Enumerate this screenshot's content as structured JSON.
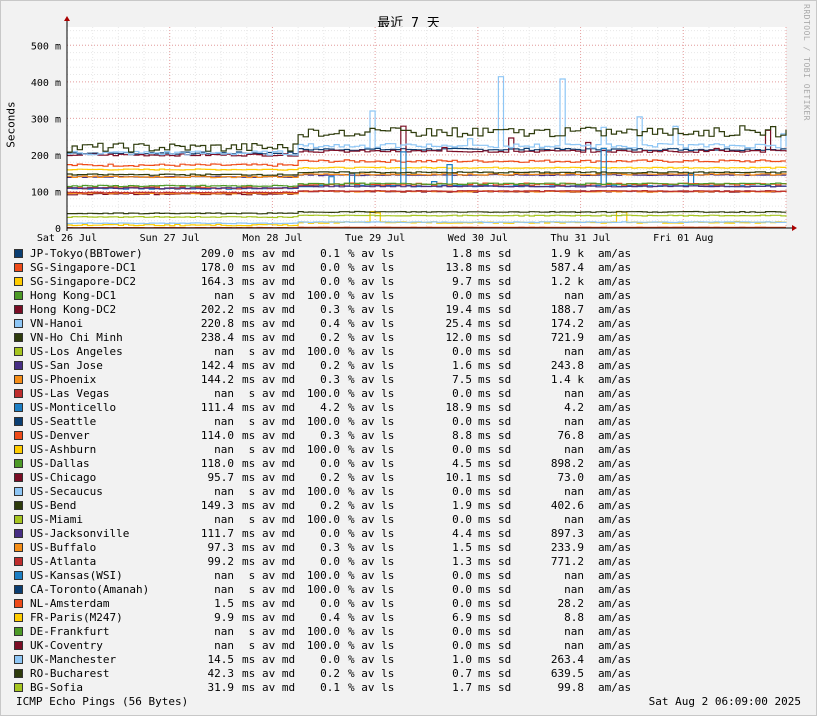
{
  "chart_data": {
    "type": "line",
    "title": "最近 7 天",
    "ylabel": "Seconds",
    "ylim": [
      0,
      0.55
    ],
    "yticks": [
      {
        "v": 0,
        "label": "0"
      },
      {
        "v": 0.1,
        "label": "100 m"
      },
      {
        "v": 0.2,
        "label": "200 m"
      },
      {
        "v": 0.3,
        "label": "300 m"
      },
      {
        "v": 0.4,
        "label": "400 m"
      },
      {
        "v": 0.5,
        "label": "500 m"
      }
    ],
    "xticks": [
      "Sat 26 Jul",
      "Sun 27 Jul",
      "Mon 28 Jul",
      "Tue 29 Jul",
      "Wed 30 Jul",
      "Thu 31 Jul",
      "Fri 01 Aug"
    ],
    "grid": true,
    "series": [
      {
        "name": "JP-Tokyo(BBTower)",
        "color": "#0b3e72",
        "median": 0.209,
        "y_hi": 0.215,
        "y_lo": 0.205,
        "spike": 0
      },
      {
        "name": "SG-Singapore-DC1",
        "color": "#ee4b19",
        "median": 0.178,
        "y_hi": 0.183,
        "y_lo": 0.172,
        "spike": 0
      },
      {
        "name": "SG-Singapore-DC2",
        "color": "#ffcc00",
        "median": 0.1643,
        "y_hi": 0.165,
        "y_lo": 0.16,
        "spike": 0
      },
      {
        "name": "Hong Kong-DC1",
        "color": "#4d9a27",
        "median": null,
        "y_hi": null,
        "y_lo": null,
        "spike": 0
      },
      {
        "name": "Hong Kong-DC2",
        "color": "#7b0d25",
        "median": 0.2022,
        "y_hi": 0.21,
        "y_lo": 0.2,
        "spike": 0.3
      },
      {
        "name": "VN-Hanoi",
        "color": "#8ec6f5",
        "median": 0.2208,
        "y_hi": 0.225,
        "y_lo": 0.205,
        "spike": 0.44
      },
      {
        "name": "VN-Ho Chi Minh",
        "color": "#2e3b0c",
        "median": 0.2384,
        "y_hi": 0.262,
        "y_lo": 0.22,
        "spike": 0.28
      },
      {
        "name": "US-Los Angeles",
        "color": "#a6c520",
        "median": null,
        "y_hi": null,
        "y_lo": null,
        "spike": 0
      },
      {
        "name": "US-San Jose",
        "color": "#472e84",
        "median": 0.1424,
        "y_hi": 0.145,
        "y_lo": 0.14,
        "spike": 0
      },
      {
        "name": "US-Phoenix",
        "color": "#f58d17",
        "median": 0.1442,
        "y_hi": 0.147,
        "y_lo": 0.14,
        "spike": 0
      },
      {
        "name": "US-Las Vegas",
        "color": "#be2d2d",
        "median": null,
        "y_hi": null,
        "y_lo": null,
        "spike": 0
      },
      {
        "name": "US-Monticello",
        "color": "#1d7fc4",
        "median": 0.1114,
        "y_hi": 0.115,
        "y_lo": 0.108,
        "spike": 0.23
      },
      {
        "name": "US-Seattle",
        "color": "#0b3e72",
        "median": null,
        "y_hi": null,
        "y_lo": null,
        "spike": 0
      },
      {
        "name": "US-Denver",
        "color": "#ee4b19",
        "median": 0.114,
        "y_hi": 0.12,
        "y_lo": 0.11,
        "spike": 0
      },
      {
        "name": "US-Ashburn",
        "color": "#ffcc00",
        "median": null,
        "y_hi": null,
        "y_lo": null,
        "spike": 0
      },
      {
        "name": "US-Dallas",
        "color": "#4d9a27",
        "median": 0.118,
        "y_hi": 0.121,
        "y_lo": 0.115,
        "spike": 0
      },
      {
        "name": "US-Chicago",
        "color": "#7b0d25",
        "median": 0.0957,
        "y_hi": 0.1,
        "y_lo": 0.093,
        "spike": 0
      },
      {
        "name": "US-Secaucus",
        "color": "#8ec6f5",
        "median": null,
        "y_hi": null,
        "y_lo": null,
        "spike": 0
      },
      {
        "name": "US-Bend",
        "color": "#2e3b0c",
        "median": 0.1493,
        "y_hi": 0.152,
        "y_lo": 0.146,
        "spike": 0
      },
      {
        "name": "US-Miami",
        "color": "#a6c520",
        "median": null,
        "y_hi": null,
        "y_lo": null,
        "spike": 0
      },
      {
        "name": "US-Jacksonville",
        "color": "#472e84",
        "median": 0.1117,
        "y_hi": 0.114,
        "y_lo": 0.109,
        "spike": 0
      },
      {
        "name": "US-Buffalo",
        "color": "#f58d17",
        "median": 0.0973,
        "y_hi": 0.1,
        "y_lo": 0.095,
        "spike": 0
      },
      {
        "name": "US-Atlanta",
        "color": "#be2d2d",
        "median": 0.0992,
        "y_hi": 0.101,
        "y_lo": 0.097,
        "spike": 0
      },
      {
        "name": "US-Kansas(WSI)",
        "color": "#1d7fc4",
        "median": null,
        "y_hi": null,
        "y_lo": null,
        "spike": 0
      },
      {
        "name": "CA-Toronto(Amanah)",
        "color": "#0b3e72",
        "median": null,
        "y_hi": null,
        "y_lo": null,
        "spike": 0
      },
      {
        "name": "NL-Amsterdam",
        "color": "#ee4b19",
        "median": 0.0015,
        "y_hi": 0.002,
        "y_lo": 0.001,
        "spike": 0
      },
      {
        "name": "FR-Paris(M247)",
        "color": "#ffcc00",
        "median": 0.0099,
        "y_hi": 0.015,
        "y_lo": 0.008,
        "spike": 0.05
      },
      {
        "name": "DE-Frankfurt",
        "color": "#4d9a27",
        "median": null,
        "y_hi": null,
        "y_lo": null,
        "spike": 0
      },
      {
        "name": "UK-Coventry",
        "color": "#7b0d25",
        "median": null,
        "y_hi": null,
        "y_lo": null,
        "spike": 0
      },
      {
        "name": "UK-Manchester",
        "color": "#8ec6f5",
        "median": 0.0145,
        "y_hi": 0.016,
        "y_lo": 0.013,
        "spike": 0
      },
      {
        "name": "RO-Bucharest",
        "color": "#2e3b0c",
        "median": 0.0423,
        "y_hi": 0.044,
        "y_lo": 0.04,
        "spike": 0
      },
      {
        "name": "BG-Sofia",
        "color": "#a6c520",
        "median": 0.0319,
        "y_hi": 0.034,
        "y_lo": 0.03,
        "spike": 0
      }
    ]
  },
  "legend": {
    "rows": [
      {
        "name": "JP-Tokyo(BBTower)",
        "avmd": "209.0",
        "avmd_unit": "ms",
        "loss": "0.1",
        "sd": "1.8",
        "sd_unit": "ms",
        "amas": "1.9 k"
      },
      {
        "name": "SG-Singapore-DC1",
        "avmd": "178.0",
        "avmd_unit": "ms",
        "loss": "0.0",
        "sd": "13.8",
        "sd_unit": "ms",
        "amas": "587.4"
      },
      {
        "name": "SG-Singapore-DC2",
        "avmd": "164.3",
        "avmd_unit": "ms",
        "loss": "0.0",
        "sd": "9.7",
        "sd_unit": "ms",
        "amas": "1.2 k"
      },
      {
        "name": "Hong Kong-DC1",
        "avmd": "nan",
        "avmd_unit": " s",
        "loss": "100.0",
        "sd": "0.0",
        "sd_unit": "ms",
        "amas": "nan"
      },
      {
        "name": "Hong Kong-DC2",
        "avmd": "202.2",
        "avmd_unit": "ms",
        "loss": "0.3",
        "sd": "19.4",
        "sd_unit": "ms",
        "amas": "188.7"
      },
      {
        "name": "VN-Hanoi",
        "avmd": "220.8",
        "avmd_unit": "ms",
        "loss": "0.4",
        "sd": "25.4",
        "sd_unit": "ms",
        "amas": "174.2"
      },
      {
        "name": "VN-Ho Chi Minh",
        "avmd": "238.4",
        "avmd_unit": "ms",
        "loss": "0.2",
        "sd": "12.0",
        "sd_unit": "ms",
        "amas": "721.9"
      },
      {
        "name": "US-Los Angeles",
        "avmd": "nan",
        "avmd_unit": " s",
        "loss": "100.0",
        "sd": "0.0",
        "sd_unit": "ms",
        "amas": "nan"
      },
      {
        "name": "US-San Jose",
        "avmd": "142.4",
        "avmd_unit": "ms",
        "loss": "0.2",
        "sd": "1.6",
        "sd_unit": "ms",
        "amas": "243.8"
      },
      {
        "name": "US-Phoenix",
        "avmd": "144.2",
        "avmd_unit": "ms",
        "loss": "0.3",
        "sd": "7.5",
        "sd_unit": "ms",
        "amas": "1.4 k"
      },
      {
        "name": "US-Las Vegas",
        "avmd": "nan",
        "avmd_unit": " s",
        "loss": "100.0",
        "sd": "0.0",
        "sd_unit": "ms",
        "amas": "nan"
      },
      {
        "name": "US-Monticello",
        "avmd": "111.4",
        "avmd_unit": "ms",
        "loss": "4.2",
        "sd": "18.9",
        "sd_unit": "ms",
        "amas": "4.2"
      },
      {
        "name": "US-Seattle",
        "avmd": "nan",
        "avmd_unit": " s",
        "loss": "100.0",
        "sd": "0.0",
        "sd_unit": "ms",
        "amas": "nan"
      },
      {
        "name": "US-Denver",
        "avmd": "114.0",
        "avmd_unit": "ms",
        "loss": "0.3",
        "sd": "8.8",
        "sd_unit": "ms",
        "amas": "76.8"
      },
      {
        "name": "US-Ashburn",
        "avmd": "nan",
        "avmd_unit": " s",
        "loss": "100.0",
        "sd": "0.0",
        "sd_unit": "ms",
        "amas": "nan"
      },
      {
        "name": "US-Dallas",
        "avmd": "118.0",
        "avmd_unit": "ms",
        "loss": "0.0",
        "sd": "4.5",
        "sd_unit": "ms",
        "amas": "898.2"
      },
      {
        "name": "US-Chicago",
        "avmd": "95.7",
        "avmd_unit": "ms",
        "loss": "0.2",
        "sd": "10.1",
        "sd_unit": "ms",
        "amas": "73.0"
      },
      {
        "name": "US-Secaucus",
        "avmd": "nan",
        "avmd_unit": " s",
        "loss": "100.0",
        "sd": "0.0",
        "sd_unit": "ms",
        "amas": "nan"
      },
      {
        "name": "US-Bend",
        "avmd": "149.3",
        "avmd_unit": "ms",
        "loss": "0.2",
        "sd": "1.9",
        "sd_unit": "ms",
        "amas": "402.6"
      },
      {
        "name": "US-Miami",
        "avmd": "nan",
        "avmd_unit": " s",
        "loss": "100.0",
        "sd": "0.0",
        "sd_unit": "ms",
        "amas": "nan"
      },
      {
        "name": "US-Jacksonville",
        "avmd": "111.7",
        "avmd_unit": "ms",
        "loss": "0.0",
        "sd": "4.4",
        "sd_unit": "ms",
        "amas": "897.3"
      },
      {
        "name": "US-Buffalo",
        "avmd": "97.3",
        "avmd_unit": "ms",
        "loss": "0.3",
        "sd": "1.5",
        "sd_unit": "ms",
        "amas": "233.9"
      },
      {
        "name": "US-Atlanta",
        "avmd": "99.2",
        "avmd_unit": "ms",
        "loss": "0.0",
        "sd": "1.3",
        "sd_unit": "ms",
        "amas": "771.2"
      },
      {
        "name": "US-Kansas(WSI)",
        "avmd": "nan",
        "avmd_unit": " s",
        "loss": "100.0",
        "sd": "0.0",
        "sd_unit": "ms",
        "amas": "nan"
      },
      {
        "name": "CA-Toronto(Amanah)",
        "avmd": "nan",
        "avmd_unit": " s",
        "loss": "100.0",
        "sd": "0.0",
        "sd_unit": "ms",
        "amas": "nan"
      },
      {
        "name": "NL-Amsterdam",
        "avmd": "1.5",
        "avmd_unit": "ms",
        "loss": "0.0",
        "sd": "0.0",
        "sd_unit": "ms",
        "amas": "28.2"
      },
      {
        "name": "FR-Paris(M247)",
        "avmd": "9.9",
        "avmd_unit": "ms",
        "loss": "0.4",
        "sd": "6.9",
        "sd_unit": "ms",
        "amas": "8.8"
      },
      {
        "name": "DE-Frankfurt",
        "avmd": "nan",
        "avmd_unit": " s",
        "loss": "100.0",
        "sd": "0.0",
        "sd_unit": "ms",
        "amas": "nan"
      },
      {
        "name": "UK-Coventry",
        "avmd": "nan",
        "avmd_unit": " s",
        "loss": "100.0",
        "sd": "0.0",
        "sd_unit": "ms",
        "amas": "nan"
      },
      {
        "name": "UK-Manchester",
        "avmd": "14.5",
        "avmd_unit": "ms",
        "loss": "0.0",
        "sd": "1.0",
        "sd_unit": "ms",
        "amas": "263.4"
      },
      {
        "name": "RO-Bucharest",
        "avmd": "42.3",
        "avmd_unit": "ms",
        "loss": "0.2",
        "sd": "0.7",
        "sd_unit": "ms",
        "amas": "639.5"
      },
      {
        "name": "BG-Sofia",
        "avmd": "31.9",
        "avmd_unit": "ms",
        "loss": "0.1",
        "sd": "1.7",
        "sd_unit": "ms",
        "amas": "99.8"
      }
    ],
    "avmd_label": "av md",
    "loss_label": "% av ls",
    "sd_label": "sd",
    "amas_label": "am/as"
  },
  "footer": {
    "left": "ICMP Echo Pings (56 Bytes)",
    "right": "Sat Aug  2 06:09:00 2025"
  },
  "watermark": "RRDTOOL / TOBI OETIKER"
}
